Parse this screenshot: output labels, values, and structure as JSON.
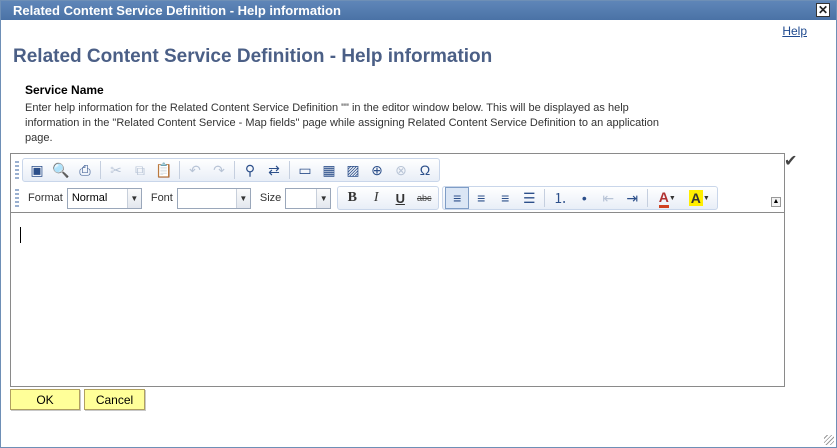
{
  "window": {
    "title": "Related Content Service Definition - Help information",
    "close_glyph": "✕"
  },
  "help_link": "Help",
  "page_title": "Related Content Service Definition - Help information",
  "section": {
    "label": "Service Name",
    "description": "Enter help information for the Related Content Service Definition \"\" in the editor window below. This will be displayed as help information in the \"Related Content Service - Map fields\" page while assigning Related Content Service Definition to an application page."
  },
  "toolbar": {
    "format_label": "Format",
    "format_value": "Normal",
    "font_label": "Font",
    "font_value": "",
    "size_label": "Size",
    "size_value": "",
    "row1_icons": [
      "source-icon",
      "preview-icon",
      "print-icon",
      "cut-icon",
      "copy-icon",
      "paste-icon",
      "undo-icon",
      "redo-icon",
      "find-icon",
      "replace-icon",
      "horizontal-rule-icon",
      "table-icon",
      "image-icon",
      "link-icon",
      "unlink-icon",
      "special-char-icon"
    ],
    "bold": "B",
    "italic": "I",
    "underline": "U",
    "strike": "abc",
    "text_color_glyph": "A",
    "bg_color_glyph": "A"
  },
  "buttons": {
    "ok": "OK",
    "cancel": "Cancel"
  },
  "colors": {
    "titlebar": "#4a72a6",
    "page_title": "#4b5f86",
    "button_bg": "#ffff99"
  }
}
